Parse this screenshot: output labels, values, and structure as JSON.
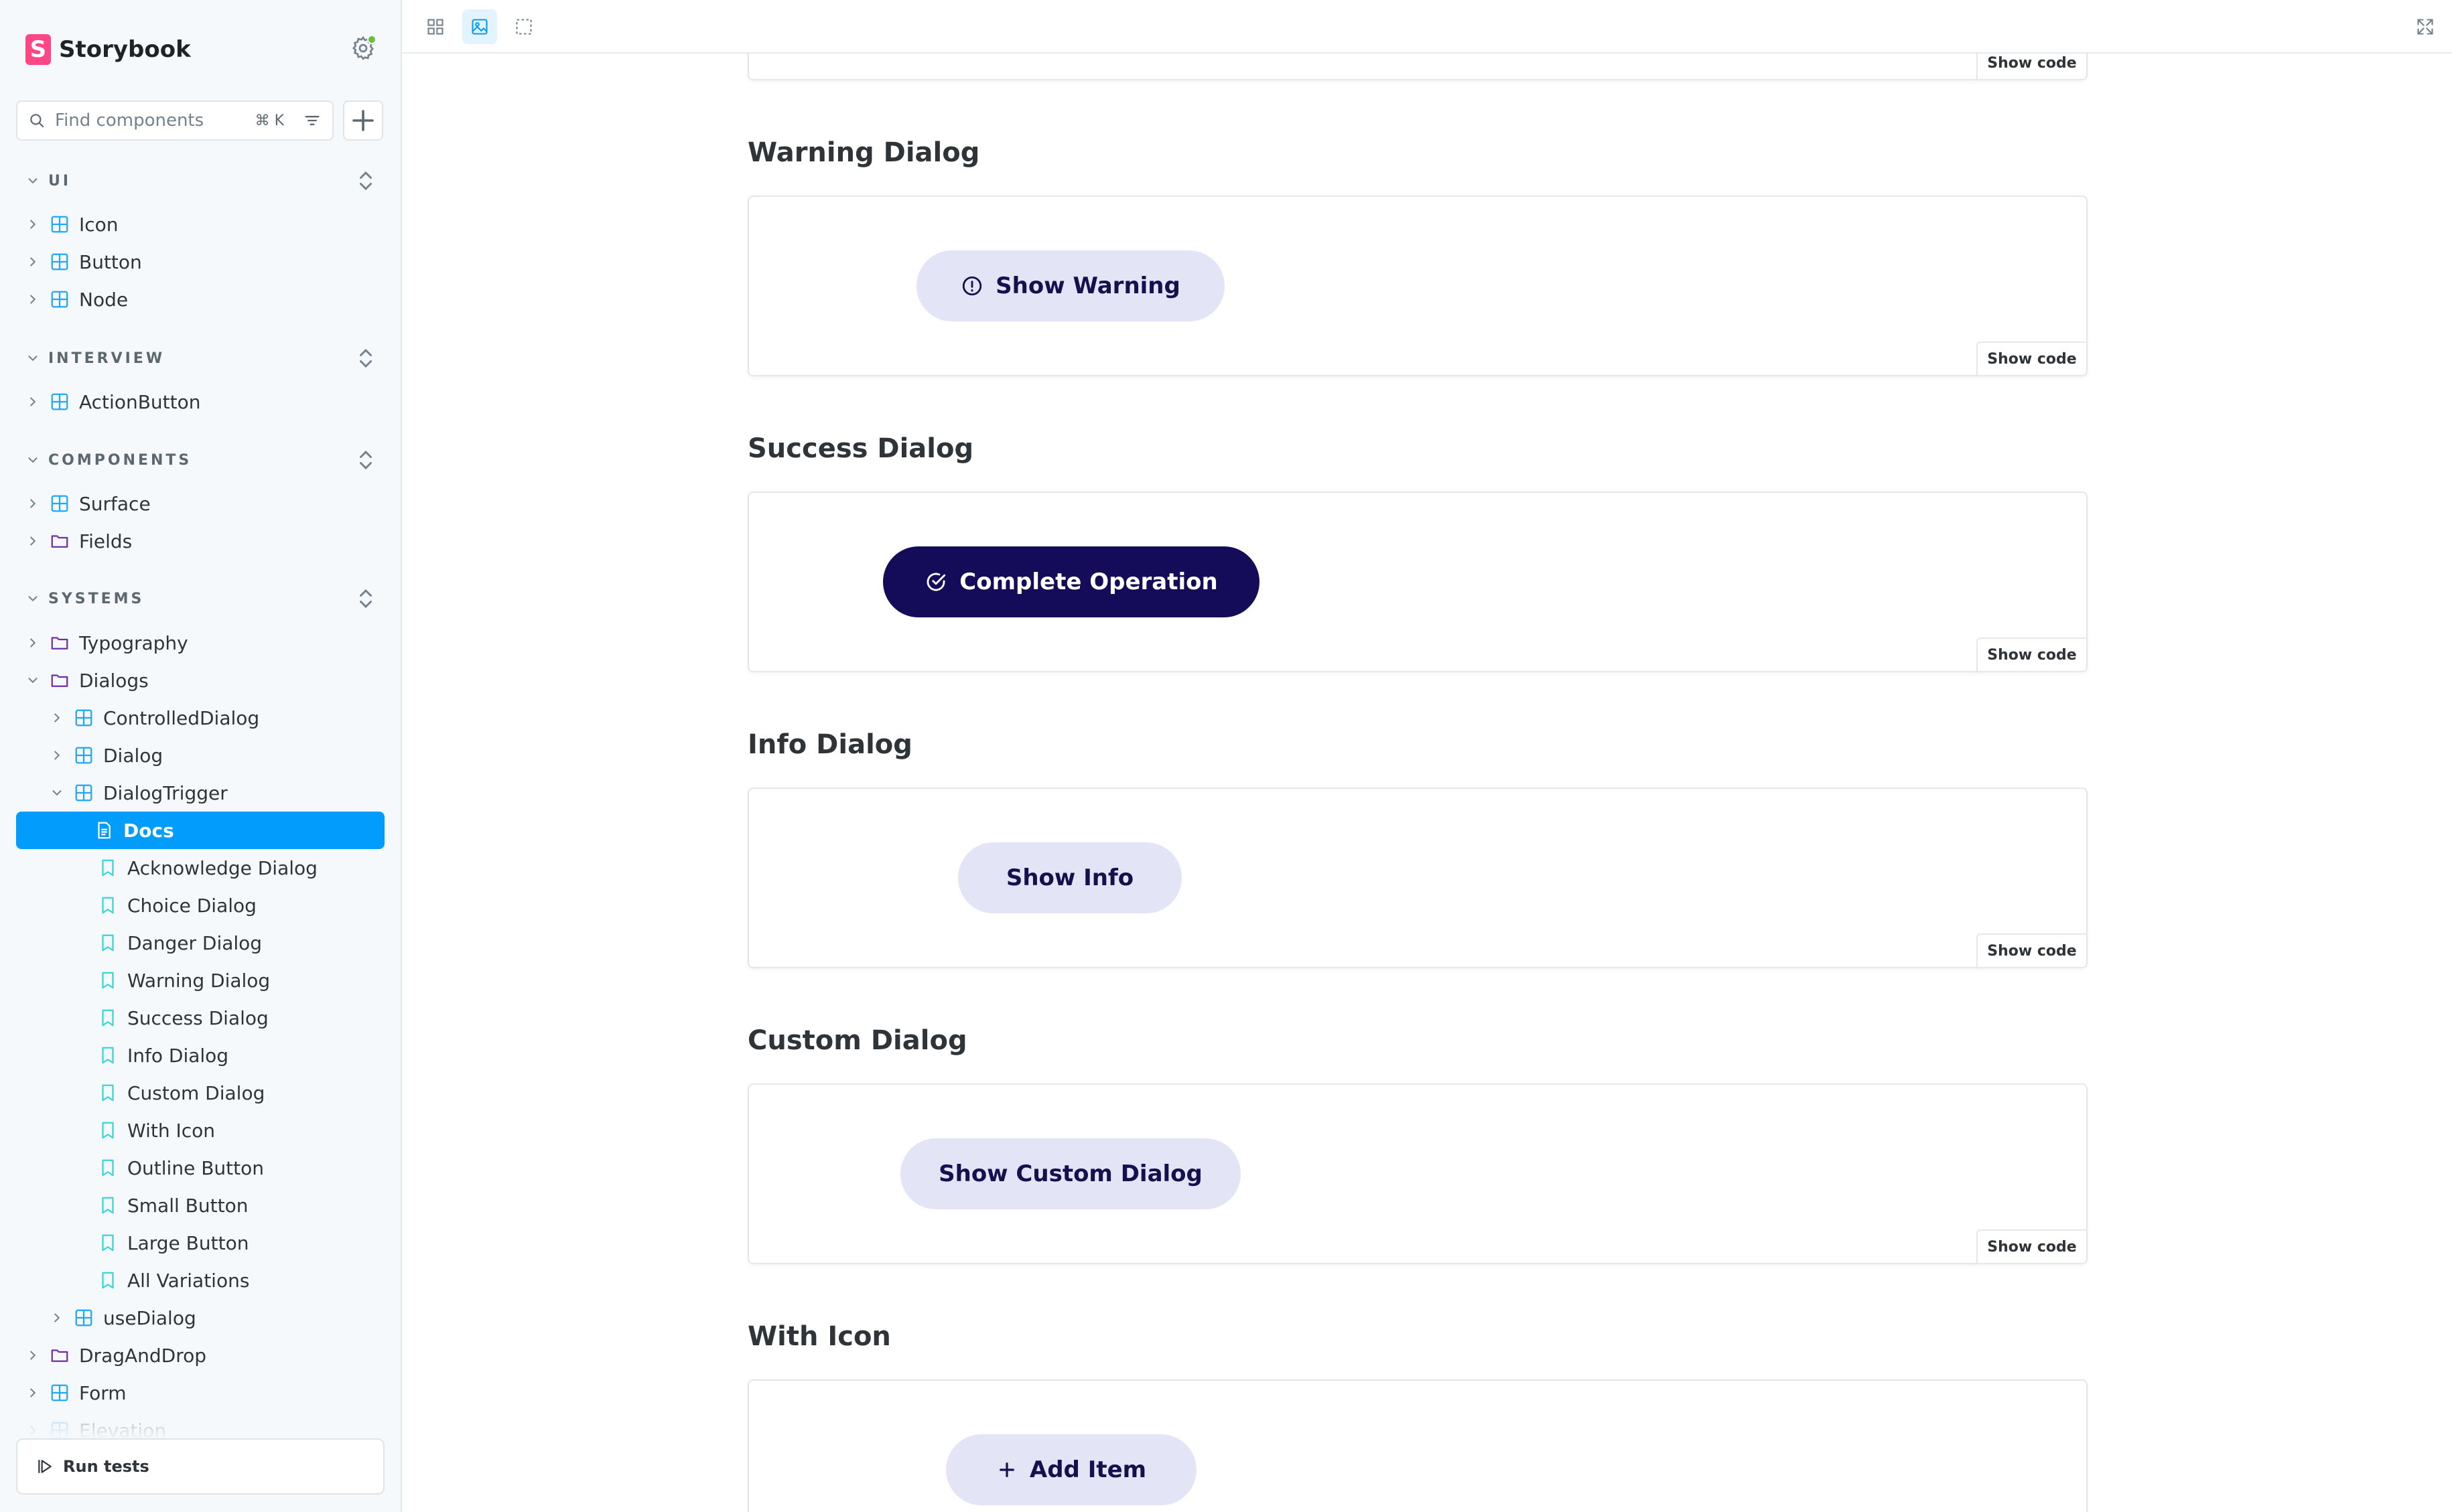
{
  "app": {
    "name": "Storybook",
    "logo_letter": "S"
  },
  "search": {
    "placeholder": "Find components",
    "shortcut": "⌘ K"
  },
  "sidebar": {
    "sections": [
      {
        "label": "UI"
      },
      {
        "label": "INTERVIEW"
      },
      {
        "label": "COMPONENTS"
      },
      {
        "label": "SYSTEMS"
      }
    ],
    "items": [
      {
        "label": "Icon",
        "kind": "component"
      },
      {
        "label": "Button",
        "kind": "component"
      },
      {
        "label": "Node",
        "kind": "component"
      },
      {
        "label": "ActionButton",
        "kind": "component"
      },
      {
        "label": "Surface",
        "kind": "component"
      },
      {
        "label": "Fields",
        "kind": "folder"
      },
      {
        "label": "Typography",
        "kind": "folder"
      },
      {
        "label": "Dialogs",
        "kind": "folder",
        "expanded": true
      },
      {
        "label": "ControlledDialog",
        "kind": "component"
      },
      {
        "label": "Dialog",
        "kind": "component"
      },
      {
        "label": "DialogTrigger",
        "kind": "component",
        "expanded": true
      },
      {
        "label": "Docs",
        "kind": "docs",
        "selected": true
      },
      {
        "label": "Acknowledge Dialog",
        "kind": "story"
      },
      {
        "label": "Choice Dialog",
        "kind": "story"
      },
      {
        "label": "Danger Dialog",
        "kind": "story"
      },
      {
        "label": "Warning Dialog",
        "kind": "story"
      },
      {
        "label": "Success Dialog",
        "kind": "story"
      },
      {
        "label": "Info Dialog",
        "kind": "story"
      },
      {
        "label": "Custom Dialog",
        "kind": "story"
      },
      {
        "label": "With Icon",
        "kind": "story"
      },
      {
        "label": "Outline Button",
        "kind": "story"
      },
      {
        "label": "Small Button",
        "kind": "story"
      },
      {
        "label": "Large Button",
        "kind": "story"
      },
      {
        "label": "All Variations",
        "kind": "story"
      },
      {
        "label": "useDialog",
        "kind": "component"
      },
      {
        "label": "DragAndDrop",
        "kind": "folder"
      },
      {
        "label": "Form",
        "kind": "component"
      },
      {
        "label": "Elevation",
        "kind": "component"
      }
    ],
    "run_tests": "Run tests"
  },
  "docs": {
    "show_code_label": "Show code",
    "stories": [
      {
        "title": "Warning Dialog",
        "button": "Show Warning",
        "icon": "alert-circle-icon",
        "style": "soft"
      },
      {
        "title": "Success Dialog",
        "button": "Complete Operation",
        "icon": "check-circle-icon",
        "style": "solid"
      },
      {
        "title": "Info Dialog",
        "button": "Show Info",
        "icon": "",
        "style": "soft"
      },
      {
        "title": "Custom Dialog",
        "button": "Show Custom Dialog",
        "icon": "",
        "style": "soft"
      },
      {
        "title": "With Icon",
        "button": "Add Item",
        "icon": "plus-icon",
        "style": "soft"
      }
    ]
  },
  "colors": {
    "accent": "#029cfd",
    "brand": "#ff4785",
    "button_soft_bg": "#e3e5f6",
    "button_solid_bg": "#140b59",
    "status_dot": "#66bf3c"
  }
}
